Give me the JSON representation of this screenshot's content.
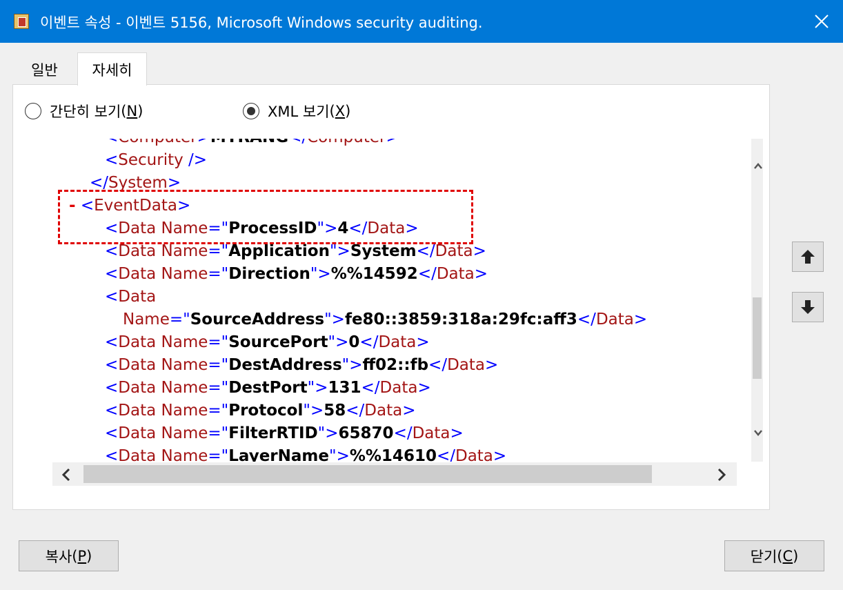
{
  "window": {
    "title": "이벤트 속성 - 이벤트 5156, Microsoft Windows security auditing."
  },
  "tabs": [
    {
      "label": "일반"
    },
    {
      "label": "자세히"
    }
  ],
  "view_mode": {
    "friendly": {
      "label": "간단히 보기",
      "mnemonic_open": "(",
      "mnemonic": "N",
      "mnemonic_close": ")",
      "selected": false
    },
    "xml": {
      "label": "XML 보기",
      "mnemonic_open": "(",
      "mnemonic": "X",
      "mnemonic_close": ")",
      "selected": true
    }
  },
  "xml": {
    "computer_open": "Computer",
    "computer_value": "MYRANG",
    "security_tag": "Security",
    "system_tag": "System",
    "collapse_marker": "-",
    "eventdata_tag": "EventData",
    "data_tag": "Data",
    "name_attr": "Name",
    "items": [
      {
        "name": "ProcessID",
        "value": "4"
      },
      {
        "name": "Application",
        "value": "System"
      },
      {
        "name": "Direction",
        "value": "%%14592"
      },
      {
        "name": "SourceAddress",
        "value": "fe80::3859:318a:29fc:aff3"
      },
      {
        "name": "SourcePort",
        "value": "0"
      },
      {
        "name": "DestAddress",
        "value": "ff02::fb"
      },
      {
        "name": "DestPort",
        "value": "131"
      },
      {
        "name": "Protocol",
        "value": "58"
      },
      {
        "name": "FilterRTID",
        "value": "65870"
      },
      {
        "name": "LayerName",
        "value": "%%14610"
      }
    ]
  },
  "buttons": {
    "copy": {
      "label": "복사",
      "mnemonic_open": "(",
      "mnemonic": "P",
      "mnemonic_close": ")"
    },
    "close": {
      "label": "닫기",
      "mnemonic_open": "(",
      "mnemonic": "C",
      "mnemonic_close": ")"
    }
  },
  "colors": {
    "titlebar": "#0078d7",
    "xml_tag": "#0000ff",
    "xml_name": "#a31515",
    "highlight": "#e00000"
  }
}
